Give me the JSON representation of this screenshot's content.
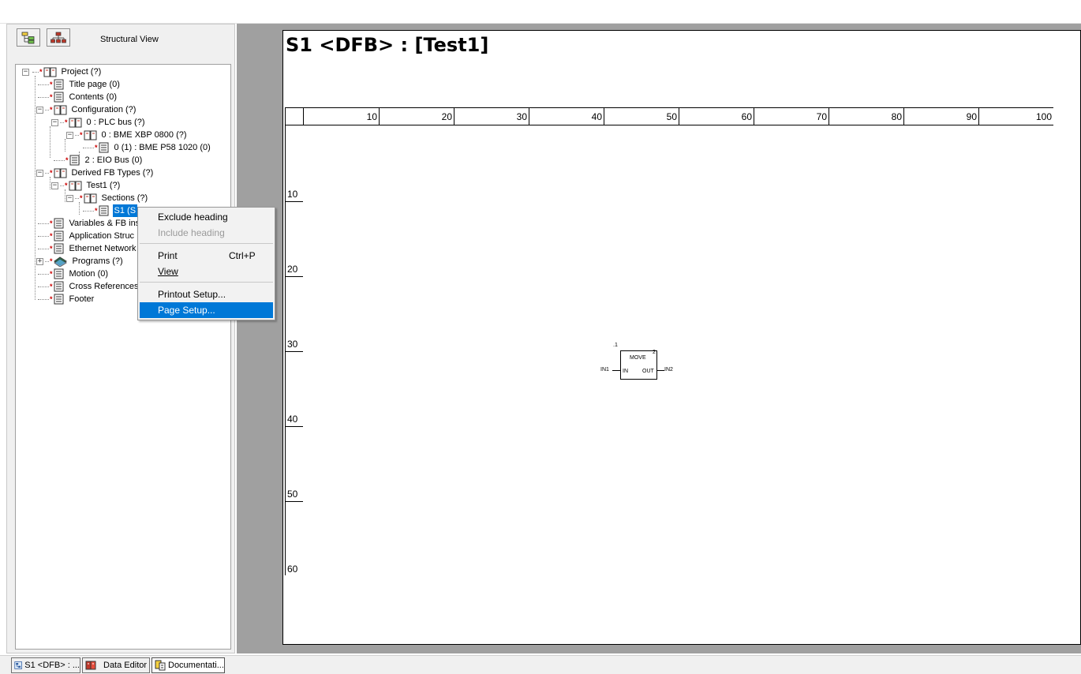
{
  "left_panel": {
    "view_label": "Structural View",
    "tree": [
      {
        "label": "Project (?)",
        "icon": "book-icon"
      },
      {
        "label": "Title page (0)",
        "icon": "page-icon"
      },
      {
        "label": "Contents (0)",
        "icon": "page-icon"
      },
      {
        "label": "Configuration (?)",
        "icon": "book-icon"
      },
      {
        "label": "0 : PLC bus (?)",
        "icon": "book-icon"
      },
      {
        "label": "0 : BME XBP 0800 (?)",
        "icon": "book-icon"
      },
      {
        "label": "0 (1) : BME P58 1020 (0)",
        "icon": "page-icon"
      },
      {
        "label": "2 : EIO Bus (0)",
        "icon": "page-icon"
      },
      {
        "label": "Derived FB Types (?)",
        "icon": "book-icon"
      },
      {
        "label": "Test1 (?)",
        "icon": "book-icon"
      },
      {
        "label": "Sections (?)",
        "icon": "book-icon"
      },
      {
        "label": "S1 (S",
        "icon": "page-icon"
      },
      {
        "label": "Variables & FB ins",
        "icon": "page-icon"
      },
      {
        "label": "Application Struc",
        "icon": "page-icon"
      },
      {
        "label": "Ethernet Network",
        "icon": "page-icon"
      },
      {
        "label": "Programs (?)",
        "icon": "books-icon"
      },
      {
        "label": "Motion (0)",
        "icon": "page-icon"
      },
      {
        "label": "Cross References",
        "icon": "page-icon"
      },
      {
        "label": "Footer",
        "icon": "page-icon"
      }
    ]
  },
  "context_menu": {
    "items": [
      {
        "label": "Exclude heading",
        "shortcut": "",
        "state": "normal"
      },
      {
        "label": "Include heading",
        "shortcut": "",
        "state": "disabled"
      },
      {
        "label": "Print",
        "shortcut": "Ctrl+P",
        "state": "normal"
      },
      {
        "label": "View",
        "shortcut": "",
        "state": "normal"
      },
      {
        "label": "Printout Setup...",
        "shortcut": "",
        "state": "normal"
      },
      {
        "label": "Page Setup...",
        "shortcut": "",
        "state": "highlighted"
      }
    ]
  },
  "sheet": {
    "title": "S1 <DFB> : [Test1]",
    "ruler_h": [
      "10",
      "20",
      "30",
      "40",
      "50",
      "60",
      "70",
      "80",
      "90",
      "100"
    ],
    "ruler_v": [
      "10",
      "20",
      "30",
      "40",
      "50",
      "60"
    ],
    "fbd": {
      "index": ".1",
      "corner": "2",
      "name": "MOVE",
      "in_var": "IN1",
      "in_pin": "IN",
      "out_pin": "OUT",
      "out_var": "IN2"
    }
  },
  "taskbar": {
    "tabs": [
      "S1 <DFB> : ...",
      "Data Editor",
      "Documentati..."
    ]
  },
  "colors": {
    "highlight": "#0078d7",
    "workspace": "#a0a0a0",
    "marker": "#cc0000"
  }
}
